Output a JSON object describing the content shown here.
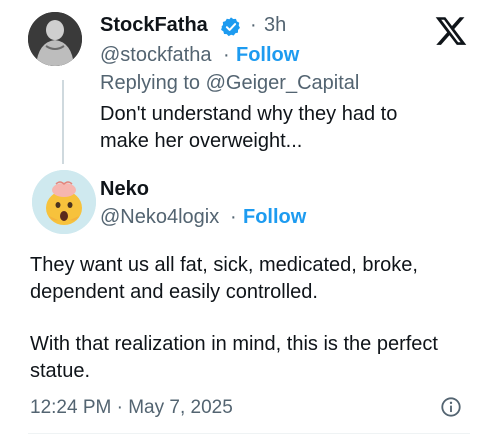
{
  "reply": {
    "display_name": "StockFatha",
    "dot": "·",
    "time": "3h",
    "handle": "@stockfatha",
    "follow_label": "Follow",
    "replying_to": "Replying to @Geiger_Capital",
    "text": "Don't understand why they had to make her overweight..."
  },
  "tweet": {
    "display_name": "Neko",
    "handle": "@Neko4logix",
    "dot": "·",
    "follow_label": "Follow",
    "text_line1": "They want us all fat, sick, medicated, broke, dependent and easily controlled.",
    "text_line2": "With that realization in mind, this is the perfect statue.",
    "timestamp": "12:24 PM · May 7, 2025"
  },
  "colors": {
    "accent": "#1d9bf0",
    "text": "#0f1419",
    "muted": "#536471"
  },
  "icons": [
    "verified-badge-icon",
    "x-logo-icon",
    "info-icon"
  ]
}
